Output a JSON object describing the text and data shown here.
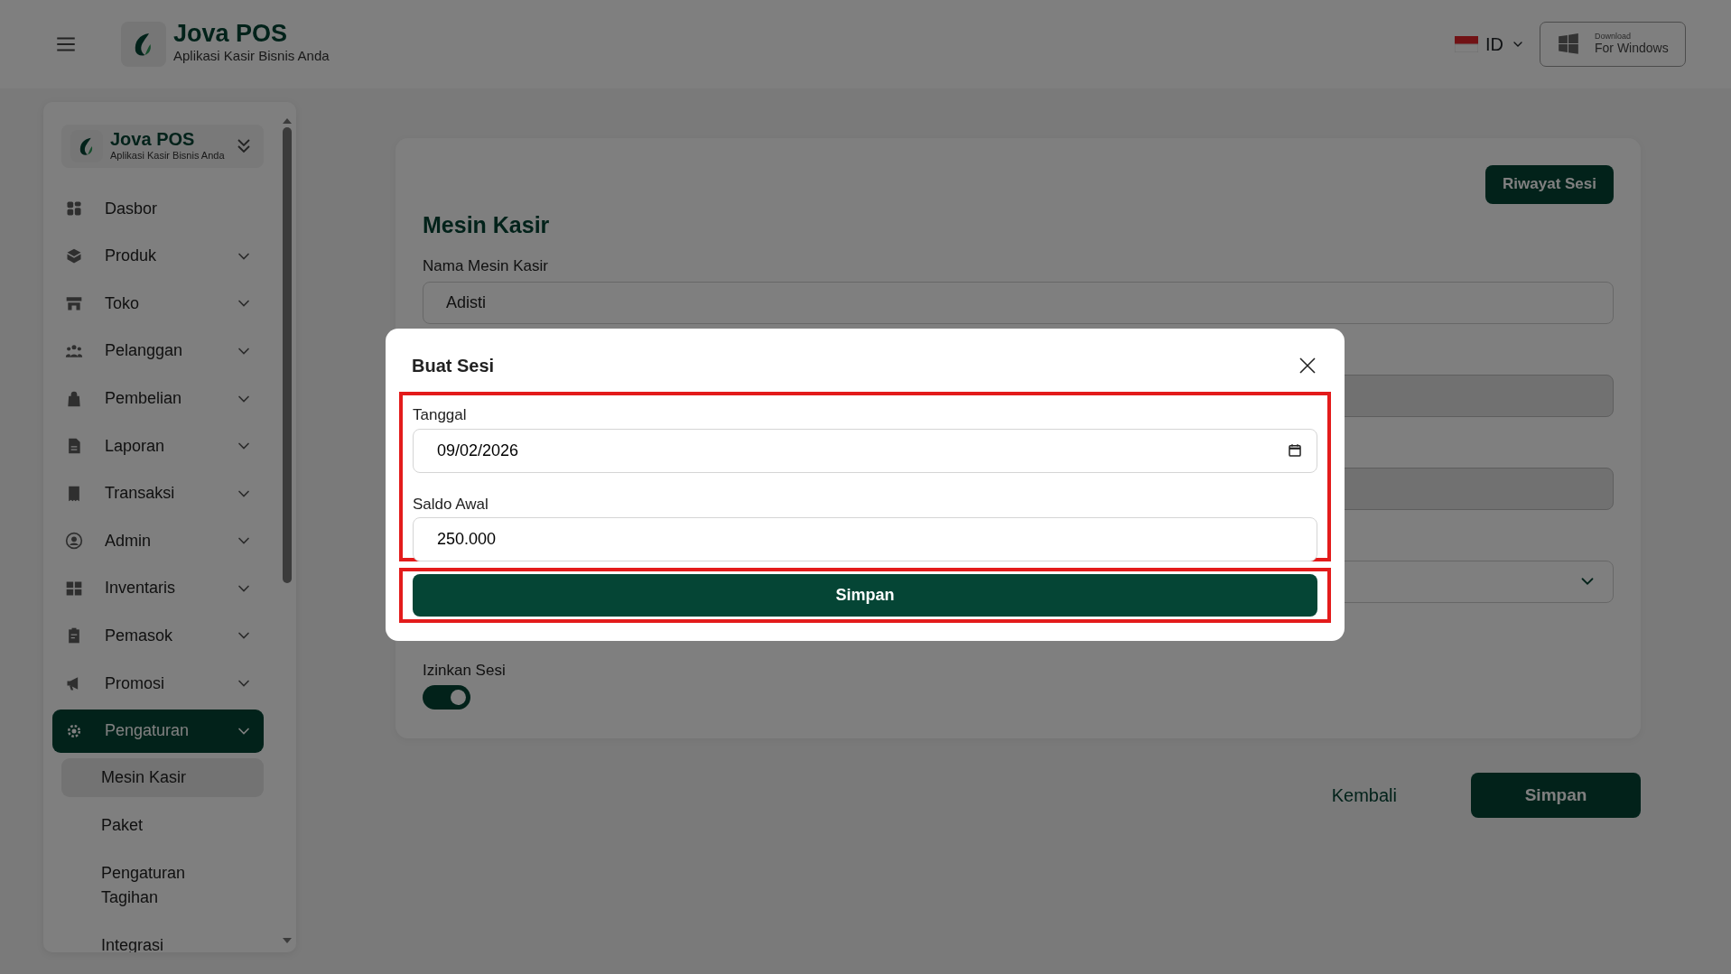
{
  "header": {
    "brand": "Jova POS",
    "tagline": "Aplikasi Kasir Bisnis Anda",
    "language": "ID",
    "download_small": "Download",
    "download_main": "For Windows"
  },
  "sidebar": {
    "brand": "Jova POS",
    "tagline": "Aplikasi Kasir Bisnis Anda",
    "items": [
      {
        "kind": "link",
        "label": "Dasbor",
        "selected": false
      },
      {
        "kind": "group",
        "label": "Produk",
        "selected": false
      },
      {
        "kind": "group",
        "label": "Toko",
        "selected": false
      },
      {
        "kind": "group",
        "label": "Pelanggan",
        "selected": false
      },
      {
        "kind": "group",
        "label": "Pembelian",
        "selected": false
      },
      {
        "kind": "group",
        "label": "Laporan",
        "selected": false
      },
      {
        "kind": "group",
        "label": "Transaksi",
        "selected": false
      },
      {
        "kind": "group",
        "label": "Admin",
        "selected": false
      },
      {
        "kind": "group",
        "label": "Inventaris",
        "selected": false
      },
      {
        "kind": "group",
        "label": "Pemasok",
        "selected": false
      },
      {
        "kind": "group",
        "label": "Promosi",
        "selected": false
      },
      {
        "kind": "group",
        "label": "Pengaturan",
        "selected": true,
        "children": [
          {
            "label": "Mesin Kasir",
            "selected": true
          },
          {
            "label": "Paket",
            "selected": false
          },
          {
            "label": "Pengaturan Tagihan",
            "selected": false
          },
          {
            "label": "Integrasi",
            "selected": false
          }
        ]
      }
    ]
  },
  "page": {
    "title": "Mesin Kasir",
    "history_button": "Riwayat Sesi",
    "fields": [
      {
        "kind": "text",
        "label": "Nama Mesin Kasir",
        "value": "Adisti",
        "disabled": false
      },
      {
        "kind": "text",
        "disabled": true
      },
      {
        "kind": "text",
        "disabled": true
      },
      {
        "kind": "select",
        "disabled": false
      }
    ],
    "toggle": {
      "label": "Izinkan Sesi",
      "on": true
    },
    "back_button": "Kembali",
    "save_button": "Simpan"
  },
  "modal": {
    "title": "Buat Sesi",
    "fields_highlighted": true,
    "button_highlighted": true,
    "fields": [
      {
        "kind": "date",
        "label": "Tanggal",
        "value": "09/02/2026"
      },
      {
        "kind": "text",
        "label": "Saldo Awal",
        "value": "250.000"
      }
    ],
    "button": "Simpan"
  }
}
